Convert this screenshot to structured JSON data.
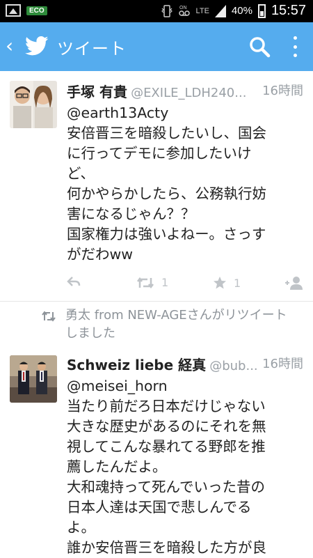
{
  "status_bar": {
    "eco": "ECO",
    "network": "LTE",
    "battery": "40%",
    "time": "15:57"
  },
  "app_bar": {
    "title": "ツイート"
  },
  "tweets": [
    {
      "name": "手塚 有貴",
      "handle": "@EXILE_LDH240...",
      "time": "16時間",
      "lines": [
        "@earth13Acty",
        "安倍晋三を暗殺したいし、国会",
        "に行ってデモに参加したいけ",
        "ど、",
        "何かやらかしたら、公務執行妨",
        "害になるじゃん？？",
        "国家権力は強いよねー。さっす",
        "がだわww"
      ],
      "retweets": "1",
      "favorites": "1"
    },
    {
      "name": "Schweiz liebe 経真",
      "handle": "@bub...",
      "time": "16時間",
      "lines": [
        "@meisei_horn",
        "当たり前だろ日本だけじゃない",
        "大きな歴史があるのにそれを無",
        "視してこんな暴れてる野郎を推",
        "薦したんだよ。",
        "大和魂持って死んでいった昔の",
        "日本人達は天国で悲しんでる",
        "よ。",
        "誰か安倍晋三を暗殺した方が良"
      ]
    }
  ],
  "retweet_notice": [
    "勇太 from NEW-AGEさんがリツイート",
    "しました"
  ],
  "colors": {
    "twitter_blue": "#55acee",
    "status_bar": "#000000",
    "muted": "#9aa0a6"
  }
}
